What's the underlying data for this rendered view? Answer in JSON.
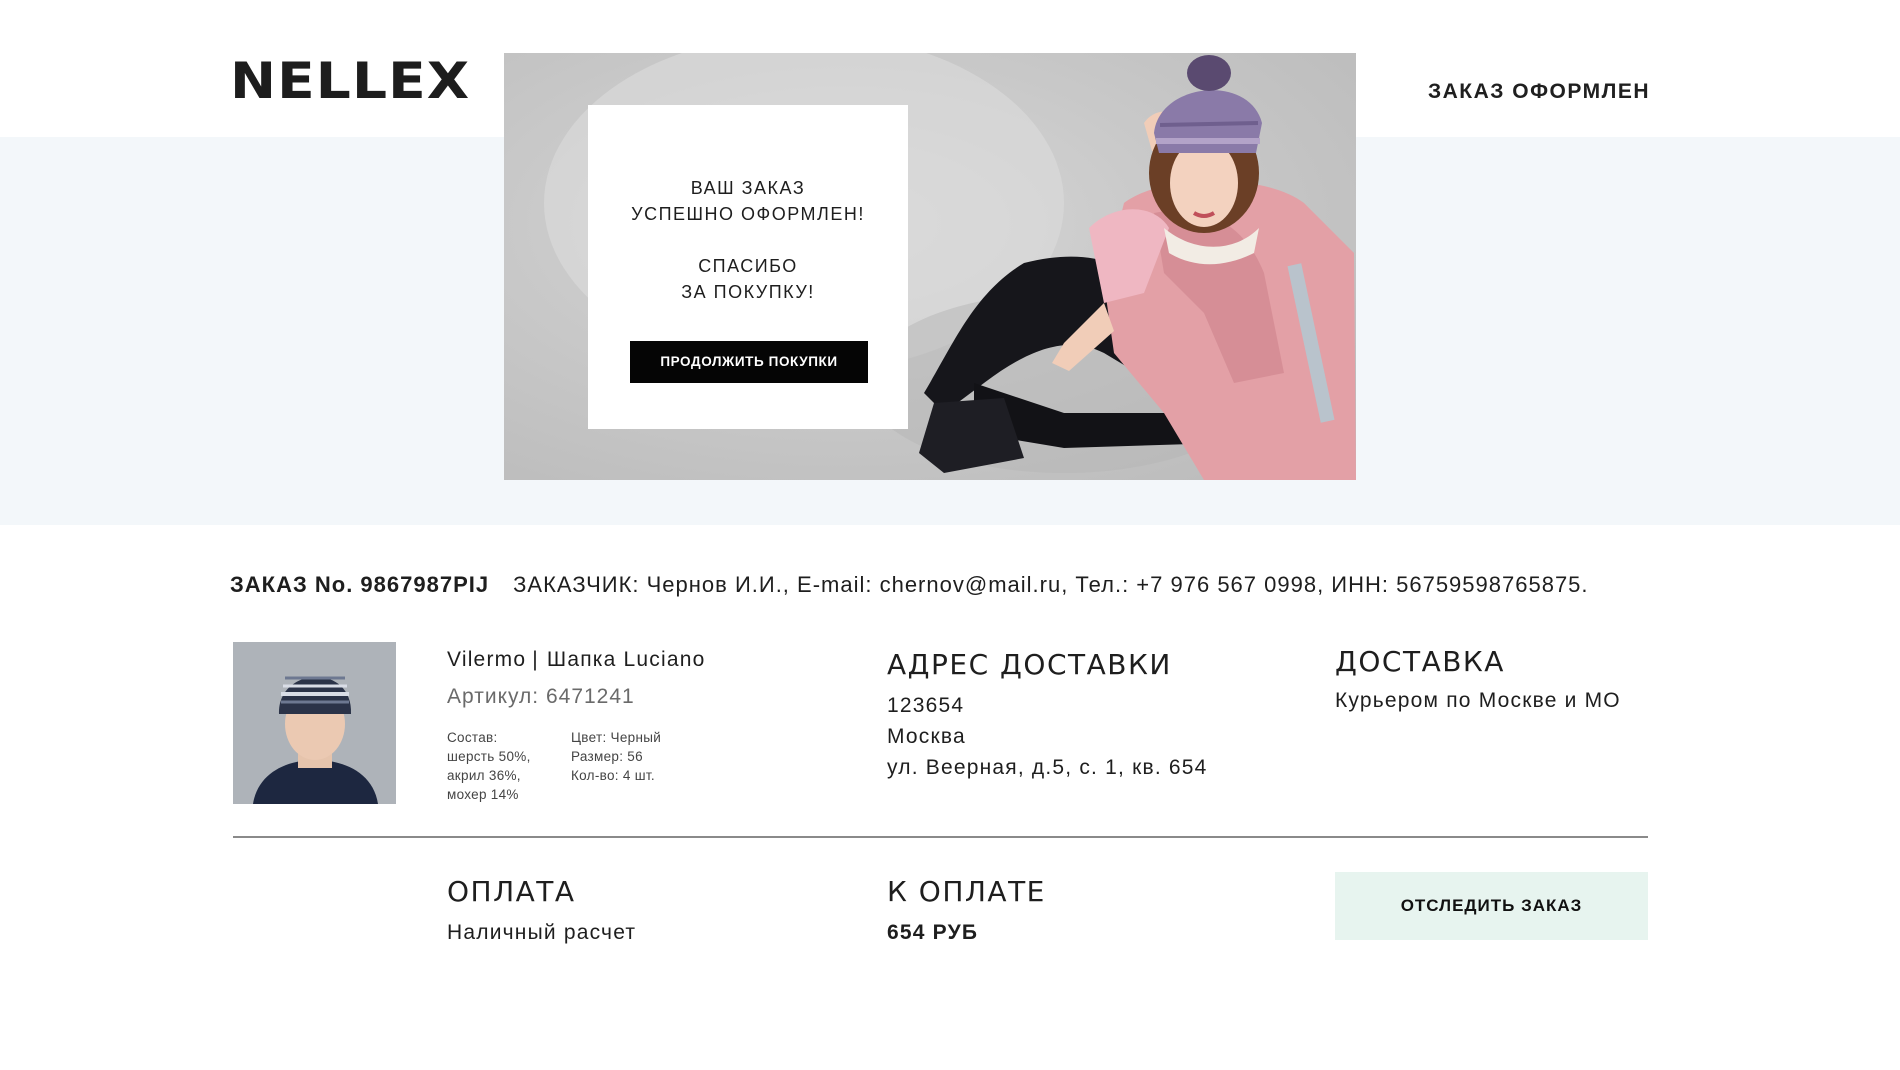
{
  "header": {
    "logo": "NELLEX",
    "status": "ЗАКАЗ ОФОРМЛЕН"
  },
  "hero": {
    "lines": [
      "ВАШ ЗАКАЗ",
      "УСПЕШНО ОФОРМЛЕН!",
      "",
      "СПАСИБО",
      "ЗА ПОКУПКУ!"
    ],
    "continue_label": "ПРОДОЛЖИТЬ ПОКУПКИ"
  },
  "order": {
    "number": "ЗАКАЗ No. 9867987PIJ",
    "customer": "ЗАКАЗЧИК: Чернов И.И.,  E-mail: chernov@mail.ru,  Тел.: +7 976 567 0998, ИНН: 56759598765875."
  },
  "product": {
    "brand": "Vilermo",
    "separator": "|",
    "name": "Шапка Luciano",
    "article": "Артикул: 6471241",
    "composition": [
      "Состав:",
      "шерсть 50%,",
      "акрил 36%,",
      "мохер 14%"
    ],
    "details": [
      "Цвет: Черный",
      "Размер: 56",
      "Кол-во: 4 шт."
    ]
  },
  "address": {
    "title": "АДРЕС ДОСТАВКИ",
    "lines": [
      "123654",
      "Москва",
      "ул. Веерная, д.5, с. 1, кв. 654"
    ]
  },
  "delivery": {
    "title": "ДОСТАВКА",
    "method": "Курьером по Москве и МО"
  },
  "payment": {
    "title": "ОПЛАТА",
    "method": "Наличный расчет"
  },
  "total": {
    "title": "К ОПЛАТЕ",
    "amount": "654 РУБ"
  },
  "track_label": "ОТСЛЕДИТЬ ЗАКАЗ",
  "colors": {
    "band": "#f3f7fa",
    "button_dark": "#050505",
    "button_track": "#e7f4ef",
    "coat_pink": "#e3a0a6"
  }
}
